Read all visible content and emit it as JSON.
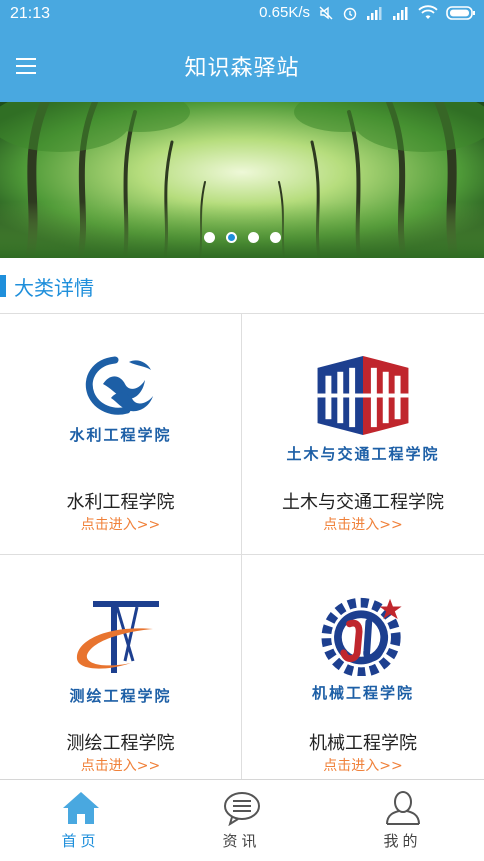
{
  "status_bar": {
    "time": "21:13",
    "network_speed": "0.65K/s"
  },
  "app_bar": {
    "title": "知识森驿站",
    "menu_icon": "hamburger-menu-icon"
  },
  "banner": {
    "slide_count": 4,
    "active_index": 1
  },
  "section": {
    "title": "大类详情"
  },
  "colleges": [
    {
      "logo_caption": "水利工程学院",
      "name": "水利工程学院",
      "enter_label": "点击进入>>"
    },
    {
      "logo_caption": "土木与交通工程学院",
      "name": "土木与交通工程学院",
      "enter_label": "点击进入>>"
    },
    {
      "logo_caption": "测绘工程学院",
      "name": "测绘工程学院",
      "enter_label": "点击进入>>"
    },
    {
      "logo_caption": "机械工程学院",
      "name": "机械工程学院",
      "enter_label": "点击进入>>"
    }
  ],
  "bottom_nav": [
    {
      "label": "首页",
      "icon": "home-icon",
      "active": true
    },
    {
      "label": "资讯",
      "icon": "chat-bubble-icon",
      "active": false
    },
    {
      "label": "我的",
      "icon": "user-icon",
      "active": false
    }
  ],
  "colors": {
    "primary": "#49a8e0",
    "accent": "#1f8fdb",
    "link_orange": "#f0813a"
  }
}
